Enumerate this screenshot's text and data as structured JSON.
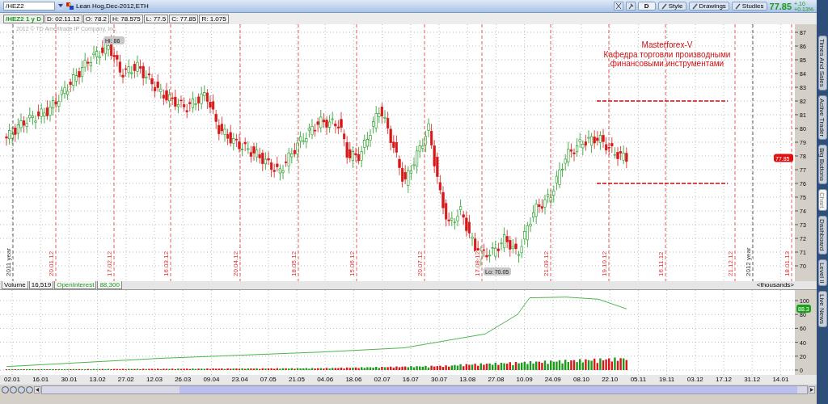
{
  "toolbar": {
    "symbol": "/HEZ2",
    "description": "Lean Hog,Dec-2012,ETH",
    "buttons": [
      {
        "label": "D",
        "kind": "toggle"
      },
      {
        "label": "Style",
        "kind": "menu"
      },
      {
        "label": "Drawings",
        "kind": "menu"
      },
      {
        "label": "Studies",
        "kind": "menu"
      }
    ],
    "last_price": "77.85",
    "change": "+.10",
    "change_percent": "+0.13%"
  },
  "info_bar": {
    "title": "/HEZ2 1 y D",
    "fields": [
      "D: 02.11.12",
      "O: 78.2",
      "H: 78.575",
      "L: 77.5",
      "C: 77.85",
      "R: 1.075"
    ]
  },
  "price_chart": {
    "copyright": "2012 © TD Ameritrade IP Company, Inc.",
    "y_ticks": [
      "87",
      "86",
      "85",
      "84",
      "83",
      "82",
      "81",
      "80",
      "79",
      "78",
      "77",
      "76",
      "75",
      "74",
      "73",
      "72",
      "71",
      "70"
    ],
    "last_price_label": "77.85",
    "high_label": "Hi: 86",
    "low_label": "Lo: 70.05",
    "annotation": {
      "title": "Masterforex-V",
      "subtitle": "Кафедра торговли производными финансовыми инструментами"
    },
    "date_markers": [
      {
        "label": "2011 year",
        "kind": "year"
      },
      {
        "label": "20.01.12",
        "kind": "date"
      },
      {
        "label": "17.02.12",
        "kind": "date"
      },
      {
        "label": "16.03.12",
        "kind": "date"
      },
      {
        "label": "20.04.12",
        "kind": "date"
      },
      {
        "label": "18.05.12",
        "kind": "date"
      },
      {
        "label": "15.06.12",
        "kind": "date"
      },
      {
        "label": "20.07.12",
        "kind": "date"
      },
      {
        "label": "17.08.12",
        "kind": "date"
      },
      {
        "label": "21.09.12",
        "kind": "date"
      },
      {
        "label": "19.10.12",
        "kind": "date"
      },
      {
        "label": "16.11.12",
        "kind": "date"
      },
      {
        "label": "21.12.12",
        "kind": "date"
      },
      {
        "label": "2012 year",
        "kind": "year"
      },
      {
        "label": "18.01.13",
        "kind": "date"
      }
    ]
  },
  "volume_pane": {
    "studies": [
      {
        "name": "Volume",
        "value": "16,519",
        "kind": "volume"
      },
      {
        "name": "OpenInterest",
        "value": "88,300",
        "kind": "open_interest"
      }
    ],
    "units": "<thousands>",
    "y_ticks": [
      "100",
      "80",
      "60",
      "40",
      "20",
      "0"
    ],
    "open_interest_label": "88.3"
  },
  "date_axis": [
    "02.01",
    "16.01",
    "30.01",
    "13.02",
    "27.02",
    "12.03",
    "26.03",
    "09.04",
    "23.04",
    "07.05",
    "21.05",
    "04.06",
    "18.06",
    "02.07",
    "16.07",
    "30.07",
    "13.08",
    "27.08",
    "10.09",
    "24.09",
    "08.10",
    "22.10",
    "05.11",
    "19.11",
    "03.12",
    "17.12",
    "31.12",
    "14.01"
  ],
  "side_tabs": [
    {
      "label": "Times And Sales",
      "selected": false
    },
    {
      "label": "Active Trader",
      "selected": false
    },
    {
      "label": "Big Buttons",
      "selected": false
    },
    {
      "label": "Chart",
      "selected": true
    },
    {
      "label": "Dashboard",
      "selected": false
    },
    {
      "label": "Level II",
      "selected": false
    },
    {
      "label": "Live News",
      "selected": false
    }
  ]
}
